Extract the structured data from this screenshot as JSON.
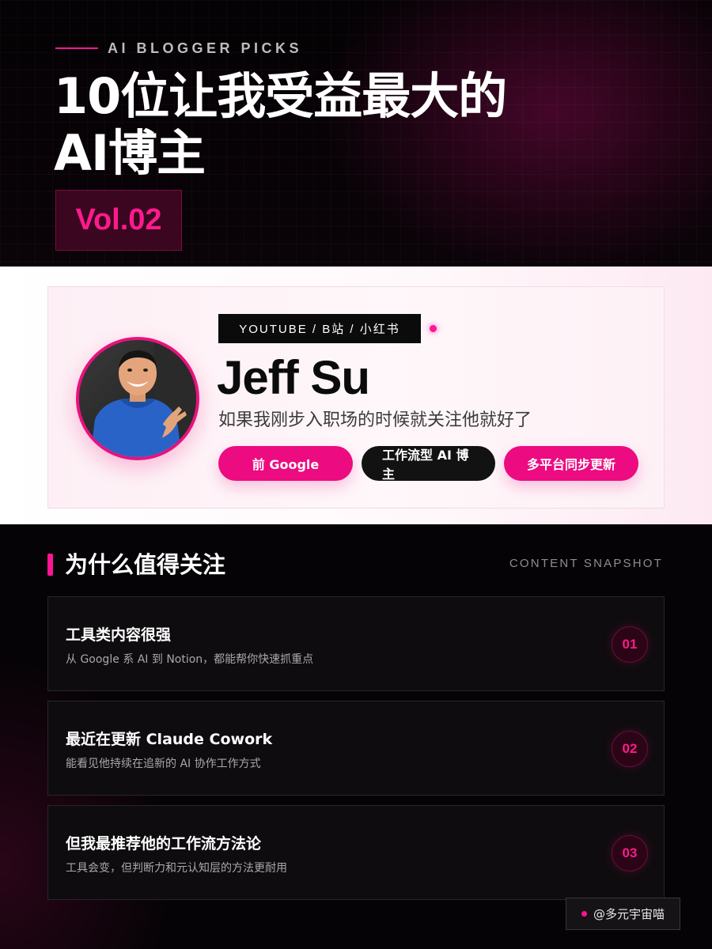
{
  "header": {
    "eyebrow": "AI BLOGGER PICKS",
    "title_line1": "10位让我受益最大的",
    "title_line2": "AI博主",
    "volume": "Vol.02"
  },
  "profile": {
    "platforms": "YOUTUBE / B站 / 小红书",
    "name": "Jeff Su",
    "tagline": "如果我刚步入职场的时候就关注他就好了",
    "tags": [
      "前 Google",
      "工作流型 AI 博主",
      "多平台同步更新"
    ]
  },
  "why": {
    "section_title": "为什么值得关注",
    "snapshot_label": "CONTENT SNAPSHOT",
    "items": [
      {
        "title": "工具类内容很强",
        "desc": "从 Google 系 AI 到 Notion，都能帮你快速抓重点",
        "num": "01"
      },
      {
        "title": "最近在更新 Claude Cowork",
        "desc": "能看见他持续在追新的 AI 协作工作方式",
        "num": "02"
      },
      {
        "title": "但我最推荐他的工作流方法论",
        "desc": "工具会变，但判断力和元认知层的方法更耐用",
        "num": "03"
      }
    ]
  },
  "footer": {
    "handle": "@多元宇宙喵"
  },
  "colors": {
    "accent": "#ec0b80",
    "background": "#050305",
    "card": "#fdeff5"
  }
}
